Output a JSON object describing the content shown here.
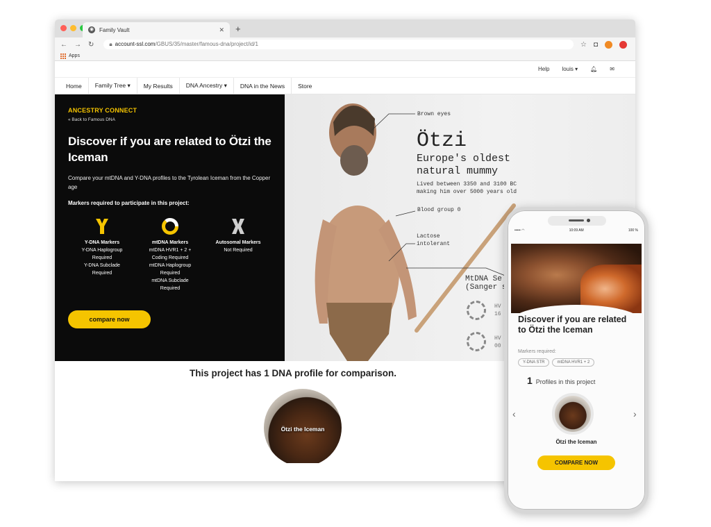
{
  "browser": {
    "tab_title": "Family Vault",
    "url_host": "account-ssl.com",
    "url_path": "/GBUS/35/master/famous-dna/project/id/1",
    "bookmarks_label": "Apps"
  },
  "utility_nav": {
    "help": "Help",
    "user": "louis ▾"
  },
  "main_nav": [
    {
      "label": "Home"
    },
    {
      "label": "Family Tree ▾"
    },
    {
      "label": "My Results"
    },
    {
      "label": "DNA Ancestry ▾"
    },
    {
      "label": "DNA in the News"
    },
    {
      "label": "Store"
    }
  ],
  "hero": {
    "eyebrow": "ANCESTRY CONNECT",
    "back_link": "« Back to Famous DNA",
    "title": "Discover if you are related to Ötzi the Iceman",
    "description": "Compare your mtDNA and Y-DNA profiles to the Tyrolean Iceman from the Copper age",
    "markers_heading": "Markers required to participate in this project:",
    "markers": [
      {
        "title": "Y-DNA Markers",
        "lines": [
          "Y-DNA Haplogroup",
          "Required",
          "Y-DNA Subclade",
          "Required"
        ]
      },
      {
        "title": "mtDNA Markers",
        "lines": [
          "mtDNA HVR1 + 2 +",
          "Coding Required",
          "mtDNA Haplogroup",
          "Required",
          "mtDNA Subclade",
          "Required"
        ]
      },
      {
        "title": "Autosomal Markers",
        "lines": [
          "Not Required"
        ]
      }
    ],
    "cta": "compare now"
  },
  "infographic": {
    "name": "Ötzi",
    "subtitle_1": "Europe's oldest",
    "subtitle_2": "natural mummy",
    "dates_1": "Lived between 3350 and 3100 BC",
    "dates_2": "making him over 5000 years old",
    "brown_eyes": "Brown eyes",
    "blood_group": "Blood group 0",
    "lactose_1": "Lactose",
    "lactose_2": "intolerant",
    "mtdna_1": "MtDNA Se",
    "mtdna_2": "(Sanger s",
    "gauge_1a": "HV",
    "gauge_1b": "16",
    "gauge_2a": "HV",
    "gauge_2b": "00"
  },
  "profiles": {
    "heading": "This project has 1 DNA profile for comparison.",
    "profile_name": "Ötzi the Iceman"
  },
  "phone": {
    "time": "10:09 AM",
    "battery": "100 %",
    "title": "Discover if you are related to Ötzi the Iceman",
    "markers_label": "Markers required:",
    "pills": [
      "Y-DNA STR",
      "mtDNA HVR1 + 2"
    ],
    "count": "1",
    "count_label": "Profiles in this project",
    "profile_name": "Ötzi the Iceman",
    "cta": "COMPARE NOW"
  },
  "colors": {
    "accent": "#f5c400",
    "hero_bg": "#0b0b0b"
  }
}
